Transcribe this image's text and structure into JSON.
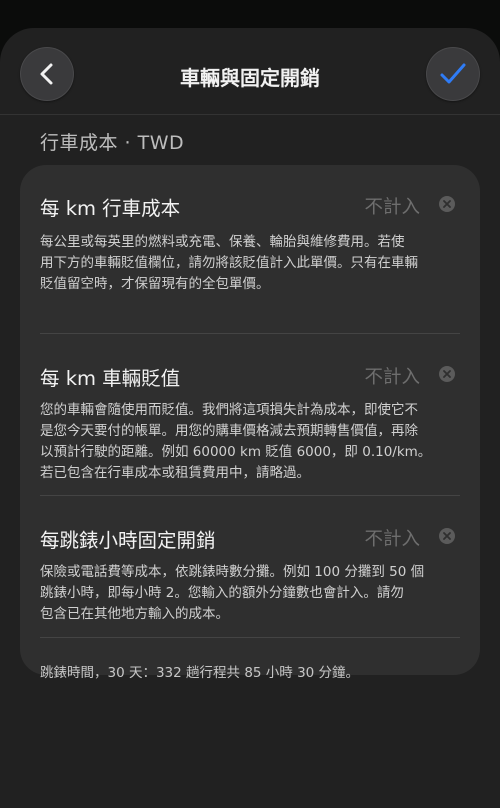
{
  "header": {
    "title": "車輛與固定開銷",
    "back_icon": "chevron-left-icon",
    "done_icon": "checkmark-icon",
    "accent_color": "#2f7cf6"
  },
  "section": {
    "title": "行車成本 · TWD"
  },
  "items": [
    {
      "label": "每 km 行車成本",
      "value": "不計入",
      "description": [
        "每公里或每英里的燃料或充電、保養、輪胎與維修費用。若使",
        "用下方的車輛貶值欄位，請勿將該貶值計入此單價。只有在車輛",
        "貶值留空時，才保留現有的全包單價。"
      ]
    },
    {
      "label": "每 km 車輛貶值",
      "value": "不計入",
      "description": [
        "您的車輛會隨使用而貶值。我們將這項損失計為成本，即使它不",
        "是您今天要付的帳單。用您的購車價格減去預期轉售價值，再除",
        "以預計行駛的距離。例如 60000 km 貶值 6000，即 0.10/km。",
        "若已包含在行車成本或租賃費用中，請略過。"
      ]
    },
    {
      "label": "每跳錶小時固定開銷",
      "value": "不計入",
      "description": [
        "保險或電話費等成本，依跳錶時數分攤。例如 100 分攤到 50 個",
        "跳錶小時，即每小時 2。您輸入的額外分鐘數也會計入。請勿",
        "包含已在其他地方輸入的成本。"
      ]
    }
  ],
  "footer": {
    "text": "跳錶時間，30 天：332 趟行程共 85 小時 30 分鐘。"
  }
}
